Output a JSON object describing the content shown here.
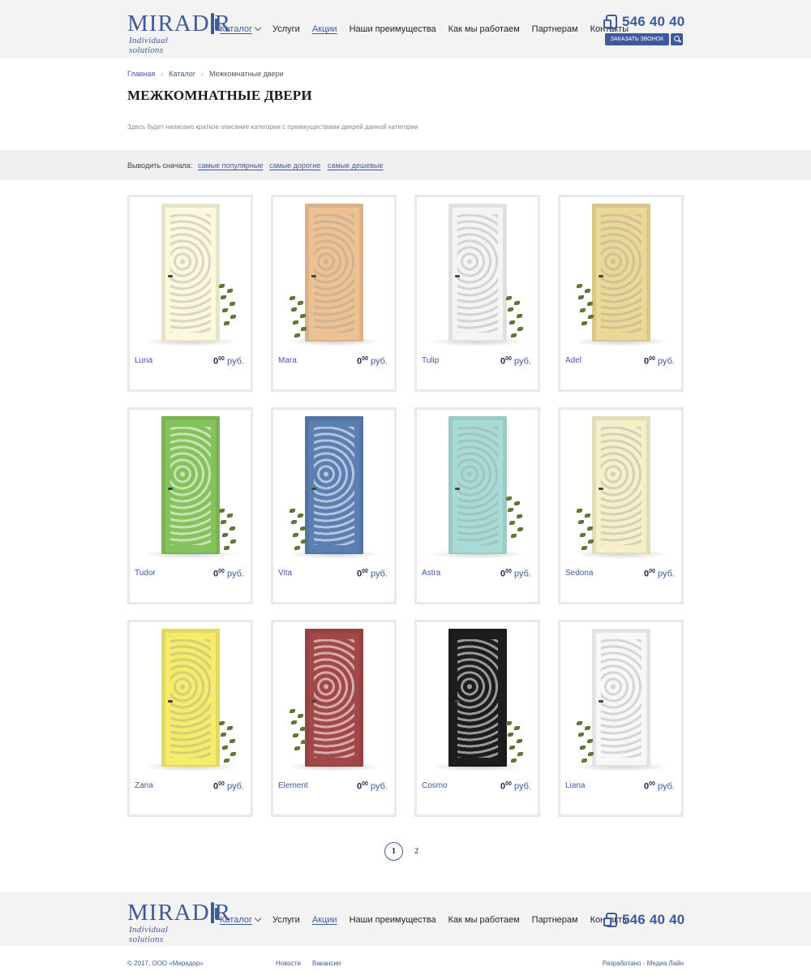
{
  "header": {
    "logo_word": "MIRADOR",
    "logo_tagline": "Individual solutions",
    "nav": [
      {
        "label": "Каталог"
      },
      {
        "label": "Услуги"
      },
      {
        "label": "Акции"
      },
      {
        "label": "Наши преимущества"
      },
      {
        "label": "Как мы работаем"
      },
      {
        "label": "Партнерам"
      },
      {
        "label": "Контакты"
      }
    ],
    "phone": "546 40 40",
    "callback_label": "ЗАКАЗАТЬ ЗВОНОК"
  },
  "breadcrumb": [
    "Главная",
    "Каталог",
    "Межкомнатные двери"
  ],
  "page": {
    "title": "МЕЖКОМНАТНЫЕ ДВЕРИ",
    "description": "Здесь будет написано краткое описание категории с преимуществами дверей данной категории"
  },
  "sort": {
    "label": "Выводить сначала:",
    "options": [
      "самые популярные",
      "самые дорогие",
      "самые дешевые"
    ]
  },
  "products": [
    {
      "name": "Luna",
      "price": "0",
      "cents": "00",
      "currency": "руб.",
      "color": "#fbf8dc"
    },
    {
      "name": "Mara",
      "price": "0",
      "cents": "00",
      "currency": "руб.",
      "color": "#eec193"
    },
    {
      "name": "Tulip",
      "price": "0",
      "cents": "00",
      "currency": "руб.",
      "color": "#f4f4f4"
    },
    {
      "name": "Adel",
      "price": "0",
      "cents": "00",
      "currency": "руб.",
      "color": "#ecd896"
    },
    {
      "name": "Tudor",
      "price": "0",
      "cents": "00",
      "currency": "руб.",
      "color": "#86c25b"
    },
    {
      "name": "Vita",
      "price": "0",
      "cents": "00",
      "currency": "руб.",
      "color": "#5b7fb2"
    },
    {
      "name": "Astra",
      "price": "0",
      "cents": "00",
      "currency": "руб.",
      "color": "#a8dbd5"
    },
    {
      "name": "Sedona",
      "price": "0",
      "cents": "00",
      "currency": "руб.",
      "color": "#f5f0c8"
    },
    {
      "name": "Zana",
      "price": "0",
      "cents": "00",
      "currency": "руб.",
      "color": "#f4ec6a"
    },
    {
      "name": "Element",
      "price": "0",
      "cents": "00",
      "currency": "руб.",
      "color": "#a34848"
    },
    {
      "name": "Cosmo",
      "price": "0",
      "cents": "00",
      "currency": "руб.",
      "color": "#1d1d1d"
    },
    {
      "name": "Liana",
      "price": "0",
      "cents": "00",
      "currency": "руб.",
      "color": "#f7f7f7"
    }
  ],
  "pagination": [
    "1",
    "2"
  ],
  "footer": {
    "copyright": "© 2017, ООО «Мирадор»",
    "links": [
      "Новости",
      "Вакансии"
    ],
    "developed_by": "Разработано - ",
    "developer": "Медиа Лайн"
  },
  "colors": {
    "accent": "#3f5a9c",
    "header_bg": "#f3f3f3",
    "card_border": "#e9e9e9"
  },
  "icons": [
    "chevron-down-icon",
    "phone-icon",
    "callback-icon",
    "search-icon",
    "door-icon"
  ]
}
